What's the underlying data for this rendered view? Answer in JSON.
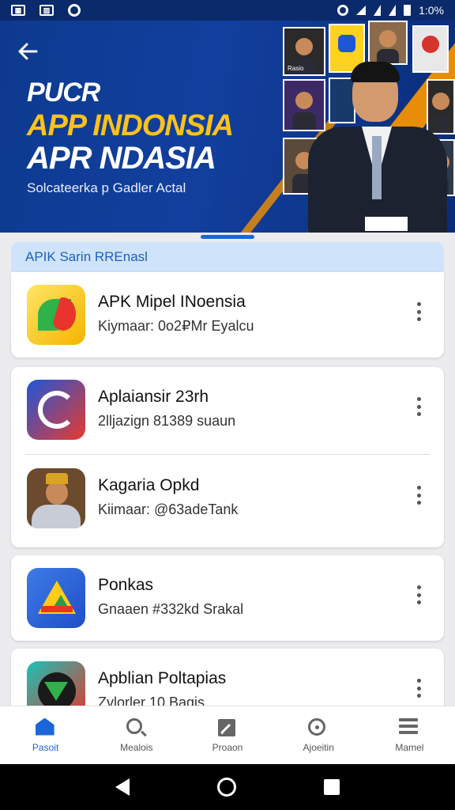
{
  "status_bar": {
    "time": "1:0%",
    "left_icons": [
      "notification-news-icon",
      "notification-image-icon",
      "notification-circle-icon"
    ],
    "right_icons": [
      "alarm-icon",
      "wifi-icon",
      "signal-icon",
      "signal-icon",
      "battery-icon"
    ]
  },
  "hero": {
    "line1": "PUCR",
    "line2": "APP INDONSIA",
    "line3": "APR NDASIA",
    "subtitle": "Solcateerka p Gadler Actal",
    "thumb_caption": "Rasio"
  },
  "list": {
    "header": "APIK Sarin RREnasl",
    "items": [
      {
        "title": "APK Mipel INoensia",
        "subtitle": "Kiymaar: 0o2₽Mr Eyalcu",
        "icon": "green-red-leaf-icon"
      },
      {
        "title": "Aplaiansir 23rh",
        "subtitle": "2lljazign 81389 suaun",
        "icon": "blue-red-swirl-icon"
      },
      {
        "title": "Kagaria Opkd",
        "subtitle": "Kiimaar: @63adeTank",
        "icon": "portrait-icon"
      },
      {
        "title": "Ponkas",
        "subtitle": "Gnaaen #332kd Srakal",
        "icon": "drive-triangle-icon"
      },
      {
        "title": "Apblian Poltapias",
        "subtitle": "Zvlorler 10 Bagis",
        "icon": "dark-disc-icon"
      }
    ]
  },
  "bottom_nav": [
    {
      "label": "Pasoit",
      "icon": "home-icon",
      "active": true
    },
    {
      "label": "Mealois",
      "icon": "search-icon",
      "active": false
    },
    {
      "label": "Proaon",
      "icon": "edit-icon",
      "active": false
    },
    {
      "label": "Ajoeitin",
      "icon": "discover-icon",
      "active": false
    },
    {
      "label": "Mamel",
      "icon": "menu-icon",
      "active": false
    }
  ],
  "colors": {
    "brand_blue": "#1b66d6",
    "hero_blue": "#0d3a8f",
    "accent_orange": "#f39200",
    "accent_yellow": "#ffc21a"
  }
}
